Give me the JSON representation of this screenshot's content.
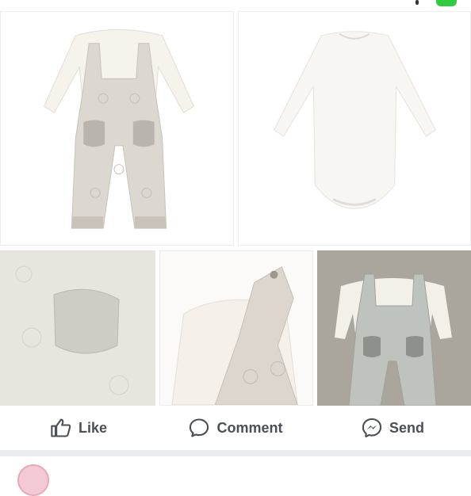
{
  "post": {
    "photos": [
      {
        "subject": "elephant dungaree and bodysuit set"
      },
      {
        "subject": "white long sleeve bodysuit"
      },
      {
        "subject": "pocket close-up"
      },
      {
        "subject": "shoulder popper close-up"
      },
      {
        "subject": "outfit laid on floor"
      }
    ]
  },
  "actions": {
    "like_label": "Like",
    "comment_label": "Comment",
    "send_label": "Send"
  },
  "icons": {
    "like": "thumbs-up-icon",
    "comment": "speech-bubble-icon",
    "send": "messenger-icon"
  },
  "colors": {
    "action_text": "#4b4f56",
    "divider": "#e9ebee",
    "status_badge": "#2ecc40"
  }
}
